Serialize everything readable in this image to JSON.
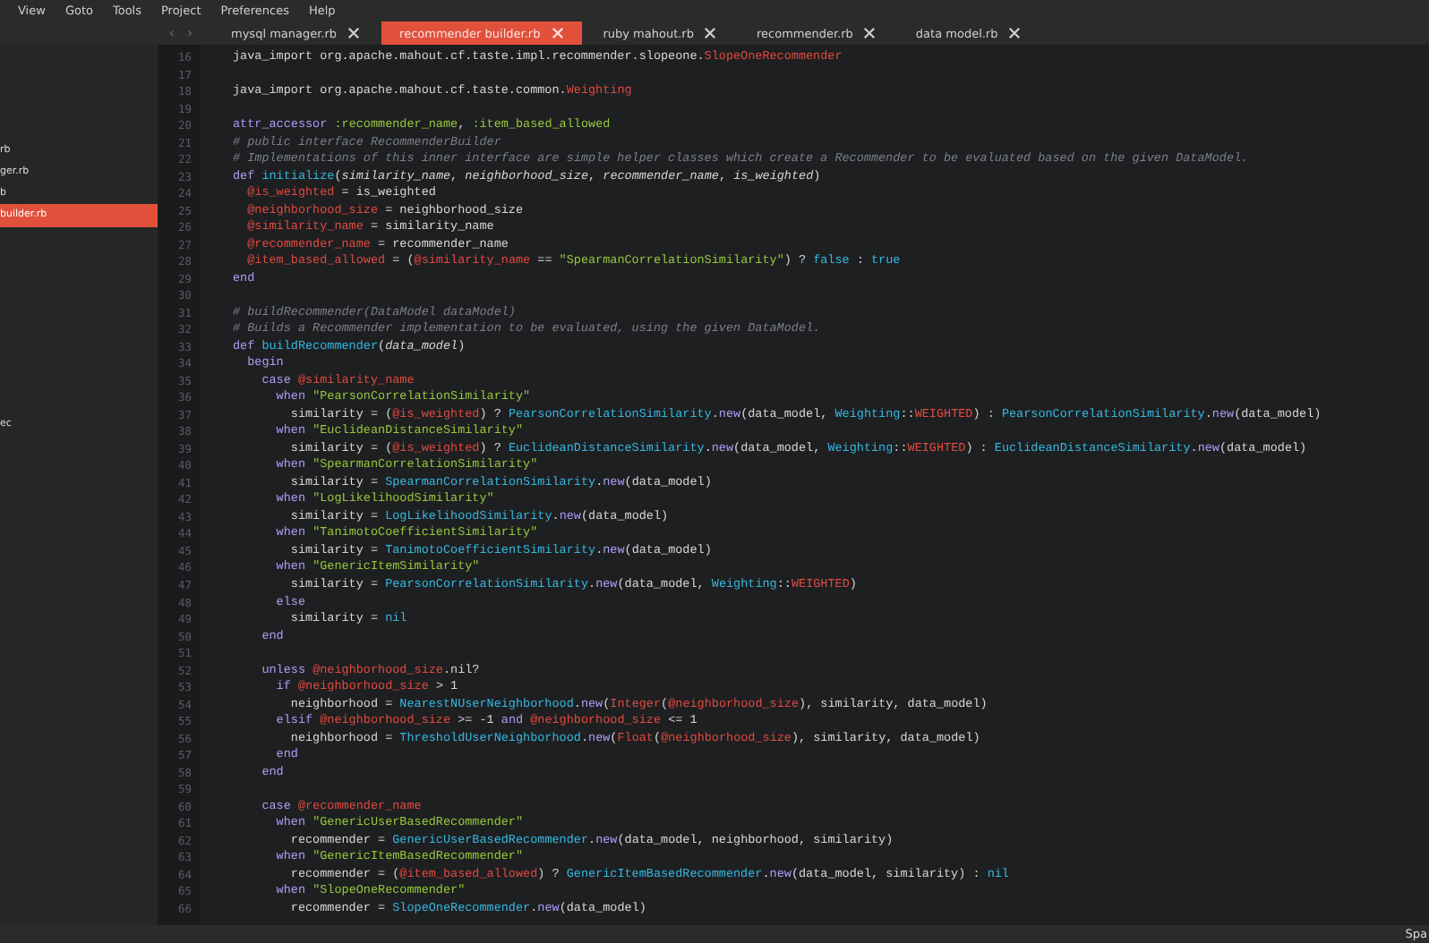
{
  "menu": [
    "View",
    "Goto",
    "Tools",
    "Project",
    "Preferences",
    "Help"
  ],
  "tab_nav": [
    "‹",
    "›"
  ],
  "tabs": [
    {
      "label": "mysql manager.rb",
      "selected": false
    },
    {
      "label": "recommender builder.rb",
      "selected": true
    },
    {
      "label": "ruby mahout.rb",
      "selected": false
    },
    {
      "label": "recommender.rb",
      "selected": false
    },
    {
      "label": "data model.rb",
      "selected": false
    }
  ],
  "sidebar": {
    "files": [
      {
        "label": "rb",
        "selected": false
      },
      {
        "label": "ger.rb",
        "selected": false
      },
      {
        "label": "b",
        "selected": false
      },
      {
        "label": "builder.rb",
        "selected": true
      }
    ],
    "other_files": [
      {
        "label": "ec",
        "selected": false
      }
    ]
  },
  "editor": {
    "lines": [
      {
        "number": "16",
        "tokens": [
          {
            "kind": "plain",
            "text": "java_import org.apache.mahout.cf.taste.impl.recommender.slopeone."
          },
          {
            "kind": "builtin",
            "text": "SlopeOneRecommender"
          }
        ]
      },
      {
        "number": "17"
      },
      {
        "number": "18",
        "tokens": [
          {
            "kind": "plain",
            "text": "java_import org.apache.mahout.cf.taste.common."
          },
          {
            "kind": "builtin",
            "text": "Weighting"
          }
        ]
      },
      {
        "number": "19"
      },
      {
        "number": "20",
        "tokens": [
          {
            "kind": "keyword",
            "text": "attr_accessor "
          },
          {
            "kind": "symbol",
            "text": ":recommender_name"
          },
          {
            "kind": "plain",
            "text": ", "
          },
          {
            "kind": "symbol",
            "text": ":item_based_allowed"
          }
        ]
      },
      {
        "number": "21",
        "tokens": [
          {
            "kind": "comment",
            "text": "# public interface RecommenderBuilder"
          }
        ]
      },
      {
        "number": "22",
        "tokens": [
          {
            "kind": "comment",
            "text": "# Implementations of this inner interface are simple helper classes which create a Recommender to be evaluated based on the given DataModel."
          }
        ]
      },
      {
        "number": "23",
        "tokens": [
          {
            "kind": "keyword",
            "text": "def "
          },
          {
            "kind": "type",
            "text": "initialize"
          },
          {
            "kind": "plain",
            "text": "("
          },
          {
            "kind": "param",
            "text": "similarity_name"
          },
          {
            "kind": "plain",
            "text": ", "
          },
          {
            "kind": "param",
            "text": "neighborhood_size"
          },
          {
            "kind": "plain",
            "text": ", "
          },
          {
            "kind": "param",
            "text": "recommender_name"
          },
          {
            "kind": "plain",
            "text": ", "
          },
          {
            "kind": "param",
            "text": "is_weighted"
          },
          {
            "kind": "plain",
            "text": ")"
          }
        ]
      },
      {
        "number": "24",
        "tokens": [
          {
            "kind": "ivar",
            "text": "  @is_weighted"
          },
          {
            "kind": "plain",
            "text": " = is_weighted"
          }
        ]
      },
      {
        "number": "25",
        "tokens": [
          {
            "kind": "ivar",
            "text": "  @neighborhood_size"
          },
          {
            "kind": "plain",
            "text": " = neighborhood_size"
          }
        ]
      },
      {
        "number": "26",
        "tokens": [
          {
            "kind": "ivar",
            "text": "  @similarity_name"
          },
          {
            "kind": "plain",
            "text": " = similarity_name"
          }
        ]
      },
      {
        "number": "27",
        "tokens": [
          {
            "kind": "ivar",
            "text": "  @recommender_name"
          },
          {
            "kind": "plain",
            "text": " = recommender_name"
          }
        ]
      },
      {
        "number": "28",
        "tokens": [
          {
            "kind": "ivar",
            "text": "  @item_based_allowed"
          },
          {
            "kind": "plain",
            "text": " = ("
          },
          {
            "kind": "ivar",
            "text": "@similarity_name"
          },
          {
            "kind": "plain",
            "text": " == "
          },
          {
            "kind": "string",
            "text": "\"SpearmanCorrelationSimilarity\""
          },
          {
            "kind": "plain",
            "text": ") ? "
          },
          {
            "kind": "literal",
            "text": "false"
          },
          {
            "kind": "plain",
            "text": " : "
          },
          {
            "kind": "literal",
            "text": "true"
          }
        ]
      },
      {
        "number": "29",
        "tokens": [
          {
            "kind": "keyword",
            "text": "end"
          }
        ]
      },
      {
        "number": "30"
      },
      {
        "number": "31",
        "tokens": [
          {
            "kind": "comment",
            "text": "# buildRecommender(DataModel dataModel)"
          }
        ]
      },
      {
        "number": "32",
        "tokens": [
          {
            "kind": "comment",
            "text": "# Builds a Recommender implementation to be evaluated, using the given DataModel."
          }
        ]
      },
      {
        "number": "33",
        "tokens": [
          {
            "kind": "keyword",
            "text": "def "
          },
          {
            "kind": "type",
            "text": "buildRecommender"
          },
          {
            "kind": "plain",
            "text": "("
          },
          {
            "kind": "param",
            "text": "data_model"
          },
          {
            "kind": "plain",
            "text": ")"
          }
        ]
      },
      {
        "number": "34",
        "tokens": [
          {
            "kind": "keyword",
            "text": "  begin"
          }
        ]
      },
      {
        "number": "35",
        "tokens": [
          {
            "kind": "keyword",
            "text": "    case "
          },
          {
            "kind": "ivar",
            "text": "@similarity_name"
          }
        ]
      },
      {
        "number": "36",
        "tokens": [
          {
            "kind": "keyword",
            "text": "      when "
          },
          {
            "kind": "string",
            "text": "\"PearsonCorrelationSimilarity\""
          }
        ]
      },
      {
        "number": "37",
        "tokens": [
          {
            "kind": "plain",
            "text": "        similarity = ("
          },
          {
            "kind": "ivar",
            "text": "@is_weighted"
          },
          {
            "kind": "plain",
            "text": ") ? "
          },
          {
            "kind": "type",
            "text": "PearsonCorrelationSimilarity"
          },
          {
            "kind": "plain",
            "text": "."
          },
          {
            "kind": "keyword",
            "text": "new"
          },
          {
            "kind": "plain",
            "text": "(data_model, "
          },
          {
            "kind": "type",
            "text": "Weighting"
          },
          {
            "kind": "plain",
            "text": "::"
          },
          {
            "kind": "builtin",
            "text": "WEIGHTED"
          },
          {
            "kind": "plain",
            "text": ") : "
          },
          {
            "kind": "type",
            "text": "PearsonCorrelationSimilarity"
          },
          {
            "kind": "plain",
            "text": "."
          },
          {
            "kind": "keyword",
            "text": "new"
          },
          {
            "kind": "plain",
            "text": "(data_model)"
          }
        ]
      },
      {
        "number": "38",
        "tokens": [
          {
            "kind": "keyword",
            "text": "      when "
          },
          {
            "kind": "string",
            "text": "\"EuclideanDistanceSimilarity\""
          }
        ]
      },
      {
        "number": "39",
        "tokens": [
          {
            "kind": "plain",
            "text": "        similarity = ("
          },
          {
            "kind": "ivar",
            "text": "@is_weighted"
          },
          {
            "kind": "plain",
            "text": ") ? "
          },
          {
            "kind": "type",
            "text": "EuclideanDistanceSimilarity"
          },
          {
            "kind": "plain",
            "text": "."
          },
          {
            "kind": "keyword",
            "text": "new"
          },
          {
            "kind": "plain",
            "text": "(data_model, "
          },
          {
            "kind": "type",
            "text": "Weighting"
          },
          {
            "kind": "plain",
            "text": "::"
          },
          {
            "kind": "builtin",
            "text": "WEIGHTED"
          },
          {
            "kind": "plain",
            "text": ") : "
          },
          {
            "kind": "type",
            "text": "EuclideanDistanceSimilarity"
          },
          {
            "kind": "plain",
            "text": "."
          },
          {
            "kind": "keyword",
            "text": "new"
          },
          {
            "kind": "plain",
            "text": "(data_model)"
          }
        ]
      },
      {
        "number": "40",
        "tokens": [
          {
            "kind": "keyword",
            "text": "      when "
          },
          {
            "kind": "string",
            "text": "\"SpearmanCorrelationSimilarity\""
          }
        ]
      },
      {
        "number": "41",
        "tokens": [
          {
            "kind": "plain",
            "text": "        similarity = "
          },
          {
            "kind": "type",
            "text": "SpearmanCorrelationSimilarity"
          },
          {
            "kind": "plain",
            "text": "."
          },
          {
            "kind": "keyword",
            "text": "new"
          },
          {
            "kind": "plain",
            "text": "(data_model)"
          }
        ]
      },
      {
        "number": "42",
        "tokens": [
          {
            "kind": "keyword",
            "text": "      when "
          },
          {
            "kind": "string",
            "text": "\"LogLikelihoodSimilarity\""
          }
        ]
      },
      {
        "number": "43",
        "tokens": [
          {
            "kind": "plain",
            "text": "        similarity = "
          },
          {
            "kind": "type",
            "text": "LogLikelihoodSimilarity"
          },
          {
            "kind": "plain",
            "text": "."
          },
          {
            "kind": "keyword",
            "text": "new"
          },
          {
            "kind": "plain",
            "text": "(data_model)"
          }
        ]
      },
      {
        "number": "44",
        "tokens": [
          {
            "kind": "keyword",
            "text": "      when "
          },
          {
            "kind": "string",
            "text": "\"TanimotoCoefficientSimilarity\""
          }
        ]
      },
      {
        "number": "45",
        "tokens": [
          {
            "kind": "plain",
            "text": "        similarity = "
          },
          {
            "kind": "type",
            "text": "TanimotoCoefficientSimilarity"
          },
          {
            "kind": "plain",
            "text": "."
          },
          {
            "kind": "keyword",
            "text": "new"
          },
          {
            "kind": "plain",
            "text": "(data_model)"
          }
        ]
      },
      {
        "number": "46",
        "tokens": [
          {
            "kind": "keyword",
            "text": "      when "
          },
          {
            "kind": "string",
            "text": "\"GenericItemSimilarity\""
          }
        ]
      },
      {
        "number": "47",
        "tokens": [
          {
            "kind": "plain",
            "text": "        similarity = "
          },
          {
            "kind": "type",
            "text": "PearsonCorrelationSimilarity"
          },
          {
            "kind": "plain",
            "text": "."
          },
          {
            "kind": "keyword",
            "text": "new"
          },
          {
            "kind": "plain",
            "text": "(data_model, "
          },
          {
            "kind": "type",
            "text": "Weighting"
          },
          {
            "kind": "plain",
            "text": "::"
          },
          {
            "kind": "builtin",
            "text": "WEIGHTED"
          },
          {
            "kind": "plain",
            "text": ")"
          }
        ]
      },
      {
        "number": "48",
        "tokens": [
          {
            "kind": "keyword",
            "text": "      else"
          }
        ]
      },
      {
        "number": "49",
        "tokens": [
          {
            "kind": "plain",
            "text": "        similarity = "
          },
          {
            "kind": "literal",
            "text": "nil"
          }
        ]
      },
      {
        "number": "50",
        "tokens": [
          {
            "kind": "keyword",
            "text": "    end"
          }
        ]
      },
      {
        "number": "51"
      },
      {
        "number": "52",
        "tokens": [
          {
            "kind": "keyword",
            "text": "    unless "
          },
          {
            "kind": "ivar",
            "text": "@neighborhood_size"
          },
          {
            "kind": "plain",
            "text": ".nil?"
          }
        ]
      },
      {
        "number": "53",
        "tokens": [
          {
            "kind": "keyword",
            "text": "      if "
          },
          {
            "kind": "ivar",
            "text": "@neighborhood_size"
          },
          {
            "kind": "plain",
            "text": " > 1"
          }
        ]
      },
      {
        "number": "54",
        "tokens": [
          {
            "kind": "plain",
            "text": "        neighborhood = "
          },
          {
            "kind": "type",
            "text": "NearestNUserNeighborhood"
          },
          {
            "kind": "plain",
            "text": "."
          },
          {
            "kind": "keyword",
            "text": "new"
          },
          {
            "kind": "plain",
            "text": "("
          },
          {
            "kind": "builtin",
            "text": "Integer"
          },
          {
            "kind": "plain",
            "text": "("
          },
          {
            "kind": "ivar",
            "text": "@neighborhood_size"
          },
          {
            "kind": "plain",
            "text": "), similarity, data_model)"
          }
        ]
      },
      {
        "number": "55",
        "tokens": [
          {
            "kind": "keyword",
            "text": "      elsif "
          },
          {
            "kind": "ivar",
            "text": "@neighborhood_size"
          },
          {
            "kind": "plain",
            "text": " >= -1 "
          },
          {
            "kind": "keyword",
            "text": "and "
          },
          {
            "kind": "ivar",
            "text": "@neighborhood_size"
          },
          {
            "kind": "plain",
            "text": " <= 1"
          }
        ]
      },
      {
        "number": "56",
        "tokens": [
          {
            "kind": "plain",
            "text": "        neighborhood = "
          },
          {
            "kind": "type",
            "text": "ThresholdUserNeighborhood"
          },
          {
            "kind": "plain",
            "text": "."
          },
          {
            "kind": "keyword",
            "text": "new"
          },
          {
            "kind": "plain",
            "text": "("
          },
          {
            "kind": "builtin",
            "text": "Float"
          },
          {
            "kind": "plain",
            "text": "("
          },
          {
            "kind": "ivar",
            "text": "@neighborhood_size"
          },
          {
            "kind": "plain",
            "text": "), similarity, data_model)"
          }
        ]
      },
      {
        "number": "57",
        "tokens": [
          {
            "kind": "keyword",
            "text": "      end"
          }
        ]
      },
      {
        "number": "58",
        "tokens": [
          {
            "kind": "keyword",
            "text": "    end"
          }
        ]
      },
      {
        "number": "59"
      },
      {
        "number": "60",
        "tokens": [
          {
            "kind": "keyword",
            "text": "    case "
          },
          {
            "kind": "ivar",
            "text": "@recommender_name"
          }
        ]
      },
      {
        "number": "61",
        "tokens": [
          {
            "kind": "keyword",
            "text": "      when "
          },
          {
            "kind": "string",
            "text": "\"GenericUserBasedRecommender\""
          }
        ]
      },
      {
        "number": "62",
        "tokens": [
          {
            "kind": "plain",
            "text": "        recommender = "
          },
          {
            "kind": "type",
            "text": "GenericUserBasedRecommender"
          },
          {
            "kind": "plain",
            "text": "."
          },
          {
            "kind": "keyword",
            "text": "new"
          },
          {
            "kind": "plain",
            "text": "(data_model, neighborhood, similarity)"
          }
        ]
      },
      {
        "number": "63",
        "tokens": [
          {
            "kind": "keyword",
            "text": "      when "
          },
          {
            "kind": "string",
            "text": "\"GenericItemBasedRecommender\""
          }
        ]
      },
      {
        "number": "64",
        "tokens": [
          {
            "kind": "plain",
            "text": "        recommender = ("
          },
          {
            "kind": "ivar",
            "text": "@item_based_allowed"
          },
          {
            "kind": "plain",
            "text": ") ? "
          },
          {
            "kind": "type",
            "text": "GenericItemBasedRecommender"
          },
          {
            "kind": "plain",
            "text": "."
          },
          {
            "kind": "keyword",
            "text": "new"
          },
          {
            "kind": "plain",
            "text": "(data_model, similarity) : "
          },
          {
            "kind": "literal",
            "text": "nil"
          }
        ]
      },
      {
        "number": "65",
        "tokens": [
          {
            "kind": "keyword",
            "text": "      when "
          },
          {
            "kind": "string",
            "text": "\"SlopeOneRecommender\""
          }
        ]
      },
      {
        "number": "66",
        "tokens": [
          {
            "kind": "plain",
            "text": "        recommender = "
          },
          {
            "kind": "type",
            "text": "SlopeOneRecommender"
          },
          {
            "kind": "plain",
            "text": "."
          },
          {
            "kind": "keyword",
            "text": "new"
          },
          {
            "kind": "plain",
            "text": "(data_model)"
          }
        ]
      }
    ]
  },
  "status_bar": {
    "text": "Spa"
  }
}
